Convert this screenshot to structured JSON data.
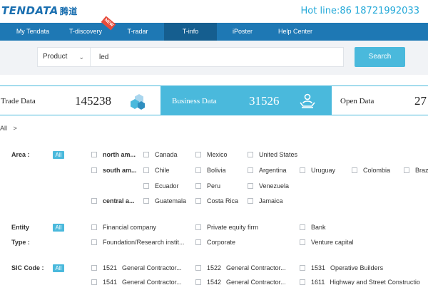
{
  "header": {
    "logo_text": "TENDATA",
    "logo_cn": "腾道",
    "hotline": "Hot line:86 18721992033"
  },
  "nav": {
    "items": [
      {
        "label": "My Tendata"
      },
      {
        "label": "T-discovery"
      },
      {
        "label": "T-radar"
      },
      {
        "label": "T-info"
      },
      {
        "label": "iPoster"
      },
      {
        "label": "Help Center"
      }
    ],
    "new_badge": "NEW"
  },
  "search": {
    "product_label": "Product",
    "query": "led",
    "button_label": "Search"
  },
  "stats": [
    {
      "label": "Trade Data",
      "value": "145238"
    },
    {
      "label": "Business Data",
      "value": "31526"
    },
    {
      "label": "Open Data",
      "value": "27"
    }
  ],
  "breadcrumb": {
    "text": "All",
    "sep": ">"
  },
  "filters": {
    "all_label": "All",
    "area": {
      "label": "Area :",
      "north_america": {
        "name": "north am...",
        "items": [
          "Canada",
          "Mexico",
          "United States"
        ]
      },
      "south_america": {
        "name": "south am...",
        "items": [
          "Chile",
          "Bolivia",
          "Argentina",
          "Uruguay",
          "Colombia",
          "Braz",
          "Ecuador",
          "Peru",
          "Venezuela"
        ]
      },
      "central_america": {
        "name": "central a...",
        "items": [
          "Guatemala",
          "Costa Rica",
          "Jamaica"
        ]
      }
    },
    "entity_type": {
      "label1": "Entity",
      "label2": "Type :",
      "items": [
        "Financial company",
        "Private equity firm",
        "Bank",
        "Foundation/Research instit...",
        "Corporate",
        "Venture capital"
      ]
    },
    "sic": {
      "label": "SIC Code :",
      "items": [
        {
          "code": "1521",
          "name": "General Contractor..."
        },
        {
          "code": "1522",
          "name": "General Contractor..."
        },
        {
          "code": "1531",
          "name": "Operative Builders"
        },
        {
          "code": "1541",
          "name": "General Contractor..."
        },
        {
          "code": "1542",
          "name": "General Contractor..."
        },
        {
          "code": "1611",
          "name": "Highway and Street Constructio"
        }
      ]
    }
  },
  "colors": {
    "nav": "#1e78b4",
    "accent": "#4ab9dc",
    "hotline": "#22a8d8"
  }
}
